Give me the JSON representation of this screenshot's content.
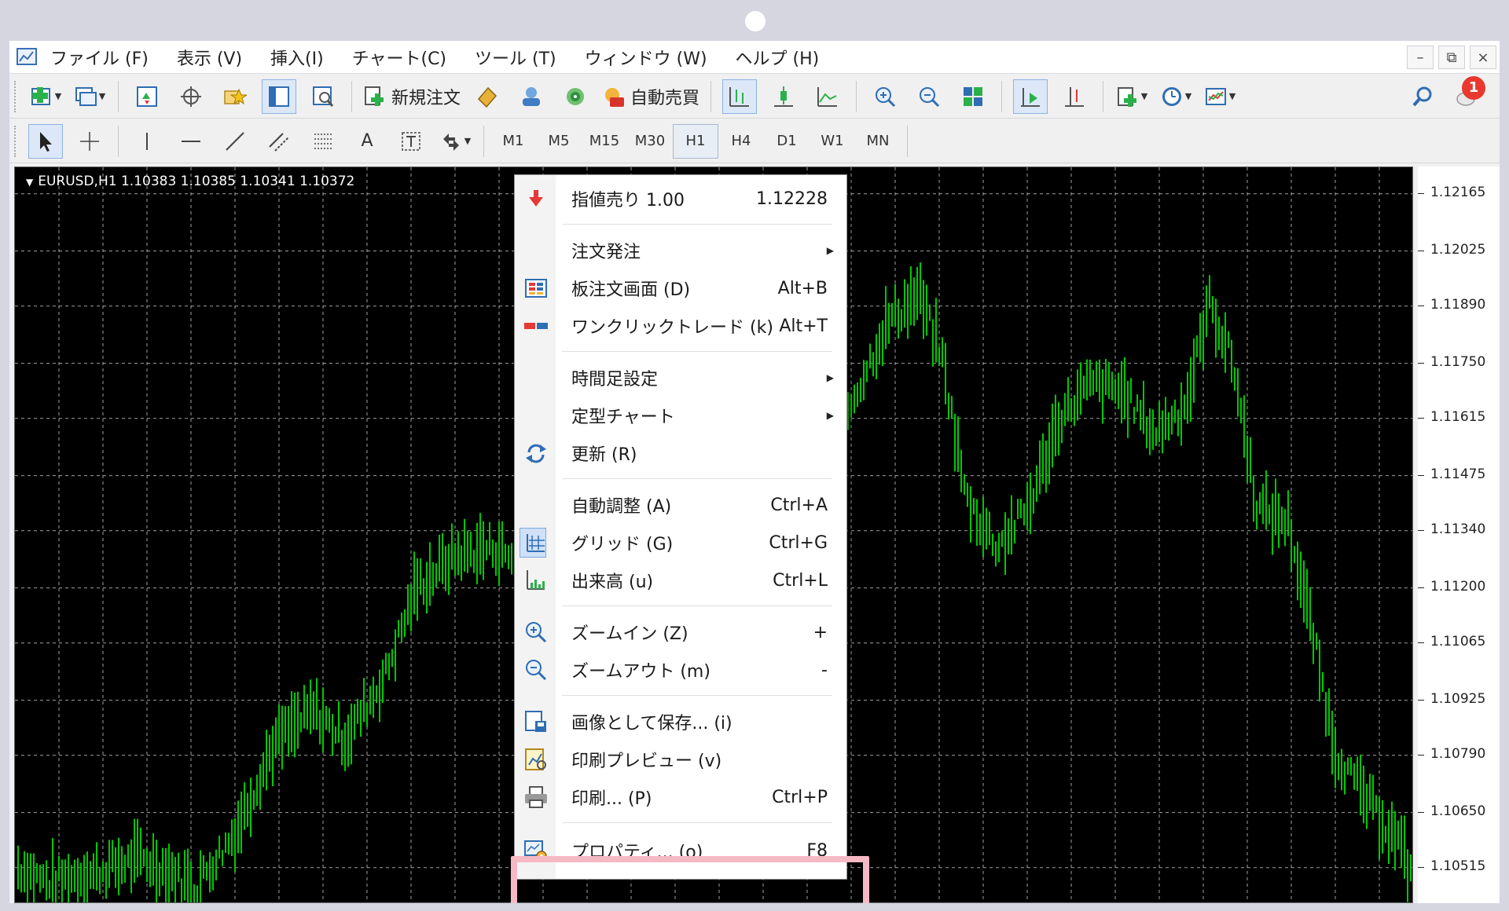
{
  "menubar": {
    "items": [
      "ファイル (F)",
      "表示 (V)",
      "挿入(I)",
      "チャート(C)",
      "ツール (T)",
      "ウィンドウ (W)",
      "ヘルプ (H)"
    ],
    "window_controls": [
      "–",
      "⧉",
      "×"
    ]
  },
  "toolbar1": {
    "new_order_label": "新規注文",
    "auto_trade_label": "自動売買",
    "notification_count": "1"
  },
  "toolbar2": {
    "text_tool": "A",
    "timeframes": [
      "M1",
      "M5",
      "M15",
      "M30",
      "H1",
      "H4",
      "D1",
      "W1",
      "MN"
    ],
    "active_timeframe": "H1"
  },
  "chart": {
    "header": "EURUSD,H1  1.10383 1.10385 1.10341 1.10372",
    "background": "#000000",
    "candle_color": "#00c800",
    "grid_color": "#c8c8c8"
  },
  "chart_data": {
    "type": "bar",
    "symbol": "EURUSD",
    "timeframe": "H1",
    "ohlc_last": {
      "open": 1.10383,
      "high": 1.10385,
      "low": 1.10341,
      "close": 1.10372
    },
    "price_ticks": [
      "1.12165",
      "1.12025",
      "1.11890",
      "1.11750",
      "1.11615",
      "1.11475",
      "1.11340",
      "1.11200",
      "1.11065",
      "1.10925",
      "1.10790",
      "1.10650",
      "1.10515"
    ],
    "ylim": [
      1.1043,
      1.1223
    ],
    "grid": true
  },
  "context_menu": {
    "items": [
      {
        "label": "指値売り 1.00",
        "shortcut": "1.12228",
        "icon": "sell-arrow-icon"
      },
      {
        "label": "注文発注",
        "submenu": true
      },
      {
        "label": "板注文画面 (D)",
        "shortcut": "Alt+B",
        "icon": "depth-of-market-icon"
      },
      {
        "label": "ワンクリックトレード (k)",
        "shortcut": "Alt+T",
        "icon": "one-click-trade-icon"
      },
      {
        "label": "時間足設定",
        "submenu": true
      },
      {
        "label": "定型チャート",
        "submenu": true
      },
      {
        "label": "更新 (R)",
        "icon": "refresh-icon"
      },
      {
        "label": "自動調整 (A)",
        "shortcut": "Ctrl+A"
      },
      {
        "label": "グリッド (G)",
        "shortcut": "Ctrl+G",
        "icon": "grid-icon",
        "checked": true
      },
      {
        "label": "出来高 (u)",
        "shortcut": "Ctrl+L",
        "icon": "volume-icon"
      },
      {
        "label": "ズームイン (Z)",
        "shortcut": "+",
        "icon": "zoom-in-icon"
      },
      {
        "label": "ズームアウト (m)",
        "shortcut": "-",
        "icon": "zoom-out-icon"
      },
      {
        "label": "画像として保存... (i)",
        "icon": "save-image-icon"
      },
      {
        "label": "印刷プレビュー (v)",
        "icon": "print-preview-icon"
      },
      {
        "label": "印刷... (P)",
        "shortcut": "Ctrl+P",
        "icon": "print-icon"
      },
      {
        "label": "プロパティ... (o)",
        "shortcut": "F8",
        "icon": "properties-icon",
        "highlighted": true
      }
    ]
  },
  "accent": {
    "highlight_box": "#f6b9c4",
    "active_button": "#dce8f8"
  }
}
